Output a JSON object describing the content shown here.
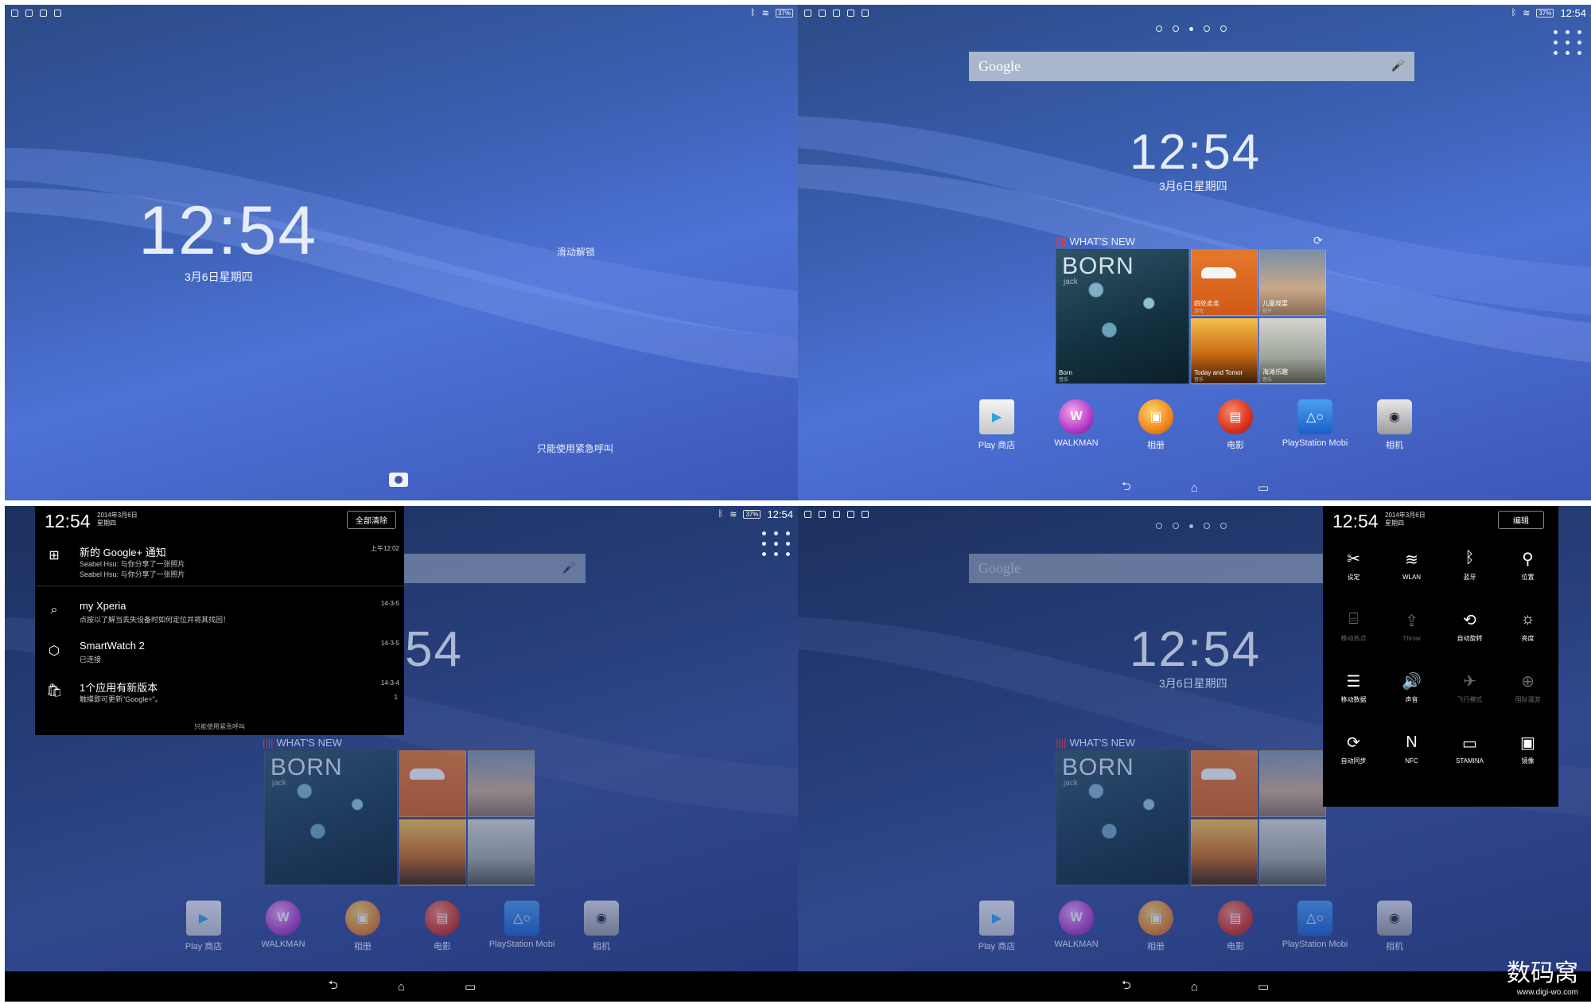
{
  "status": {
    "battery": "37%",
    "time": "12:54"
  },
  "lock": {
    "clock": "12:54",
    "date": "3月6日星期四",
    "swipe_hint": "滑动解锁",
    "emergency": "只能使用紧急呼叫"
  },
  "home": {
    "clock": "12:54",
    "date": "3月6日星期四",
    "search_label": "Google",
    "whats_new": {
      "title": "WHAT'S NEW",
      "tiles": [
        {
          "title": "BORN",
          "subtitle": "jack",
          "caption": "Born",
          "tag": "音乐"
        },
        {
          "caption": "四处走走",
          "tag": "游戏"
        },
        {
          "caption": "儿童戏耍",
          "tag": "影片"
        },
        {
          "caption": "Today and Tomor",
          "tag": "音乐"
        },
        {
          "caption": "海滩乐趣",
          "tag": "音乐"
        }
      ]
    },
    "apps": [
      {
        "label": "Play 商店",
        "icon": "play-store-icon"
      },
      {
        "label": "WALKMAN",
        "icon": "walkman-icon"
      },
      {
        "label": "相册",
        "icon": "album-icon"
      },
      {
        "label": "电影",
        "icon": "movies-icon"
      },
      {
        "label": "PlayStation Mobi",
        "icon": "playstation-icon"
      },
      {
        "label": "相机",
        "icon": "camera-icon"
      }
    ]
  },
  "notifications": {
    "time": "12:54",
    "date_line1": "2014年3月6日",
    "date_line2": "星期四",
    "clear_all": "全部清除",
    "items": [
      {
        "icon": "google-plus-icon",
        "title": "新的 Google+ 通知",
        "line1": "Seabel Hsu: 与你分享了一张照片",
        "line2": "Seabel Hsu: 与你分享了一张照片",
        "when": "上午12:02",
        "count": ""
      },
      {
        "icon": "my-xperia-icon",
        "title": "my Xperia",
        "line1": "点按以了解当丢失设备时如何定位并将其找回！",
        "line2": "",
        "when": "14-3-5",
        "count": ""
      },
      {
        "icon": "smartwatch-icon",
        "title": "SmartWatch 2",
        "line1": "已连接",
        "line2": "",
        "when": "14-3-5",
        "count": ""
      },
      {
        "icon": "store-update-icon",
        "title": "1个应用有新版本",
        "line1": "触摸即可更新\"Google+\"。",
        "line2": "",
        "when": "14-3-4",
        "count": "1"
      }
    ],
    "emergency": "只能使用紧急呼叫"
  },
  "quick_settings": {
    "time": "12:54",
    "date_line1": "2014年3月6日",
    "date_line2": "星期四",
    "edit": "编辑",
    "toggles": [
      {
        "label": "设定",
        "icon": "settings-icon",
        "on": true
      },
      {
        "label": "WLAN",
        "icon": "wifi-icon",
        "on": true
      },
      {
        "label": "蓝牙",
        "icon": "bluetooth-icon",
        "on": true
      },
      {
        "label": "位置",
        "icon": "location-icon",
        "on": true
      },
      {
        "label": "移动热点",
        "icon": "hotspot-icon",
        "on": false
      },
      {
        "label": "Throw",
        "icon": "throw-icon",
        "on": false
      },
      {
        "label": "自动旋转",
        "icon": "rotate-icon",
        "on": true
      },
      {
        "label": "亮度",
        "icon": "brightness-icon",
        "on": true
      },
      {
        "label": "移动数据",
        "icon": "mobile-data-icon",
        "on": true
      },
      {
        "label": "声音",
        "icon": "sound-icon",
        "on": true
      },
      {
        "label": "飞行模式",
        "icon": "airplane-icon",
        "on": false
      },
      {
        "label": "国际漫游",
        "icon": "roaming-icon",
        "on": false
      },
      {
        "label": "自动同步",
        "icon": "sync-icon",
        "on": true
      },
      {
        "label": "NFC",
        "icon": "nfc-icon",
        "on": true
      },
      {
        "label": "STAMINA",
        "icon": "stamina-icon",
        "on": true
      },
      {
        "label": "镜像",
        "icon": "mirror-icon",
        "on": true
      }
    ]
  },
  "watermark": {
    "brand": "数码窝",
    "url": "www.digi-wo.com"
  }
}
